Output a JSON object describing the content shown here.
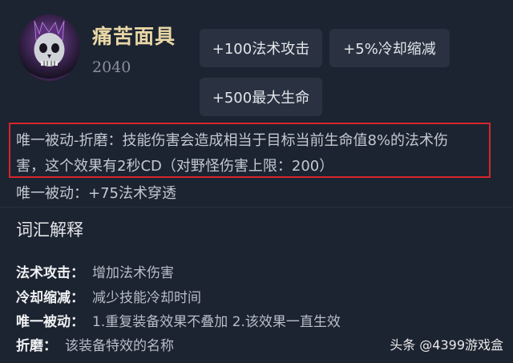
{
  "item": {
    "name": "痛苦面具",
    "price": "2040",
    "icon": "skull-mask-icon"
  },
  "stats": [
    "+100法术攻击",
    "+5%冷却缩减",
    "+500最大生命"
  ],
  "passives": {
    "torment_line1": "唯一被动-折磨：技能伤害会造成相当于目标当前生命值8%的法术伤",
    "torment_line2": "害，这个效果有2秒CD（对野怪伤害上限：200）",
    "penetration": "唯一被动：+75法术穿透"
  },
  "glossary": {
    "title": "词汇解释",
    "entries": [
      {
        "term": "法术攻击：",
        "definition": "增加法术伤害"
      },
      {
        "term": "冷却缩减：",
        "definition": "减少技能冷却时间"
      },
      {
        "term": "唯一被动：",
        "definition": "1.重复装备效果不叠加 2.该效果一直生效"
      },
      {
        "term": "折磨：",
        "definition": "该装备特效的名称"
      }
    ]
  },
  "watermark": "头条 @4399游戏盒",
  "colors": {
    "background": "#1c2431",
    "item_name": "#e9d7a6",
    "highlight_border": "#d6262c",
    "chip_bg": "#2a3242"
  }
}
